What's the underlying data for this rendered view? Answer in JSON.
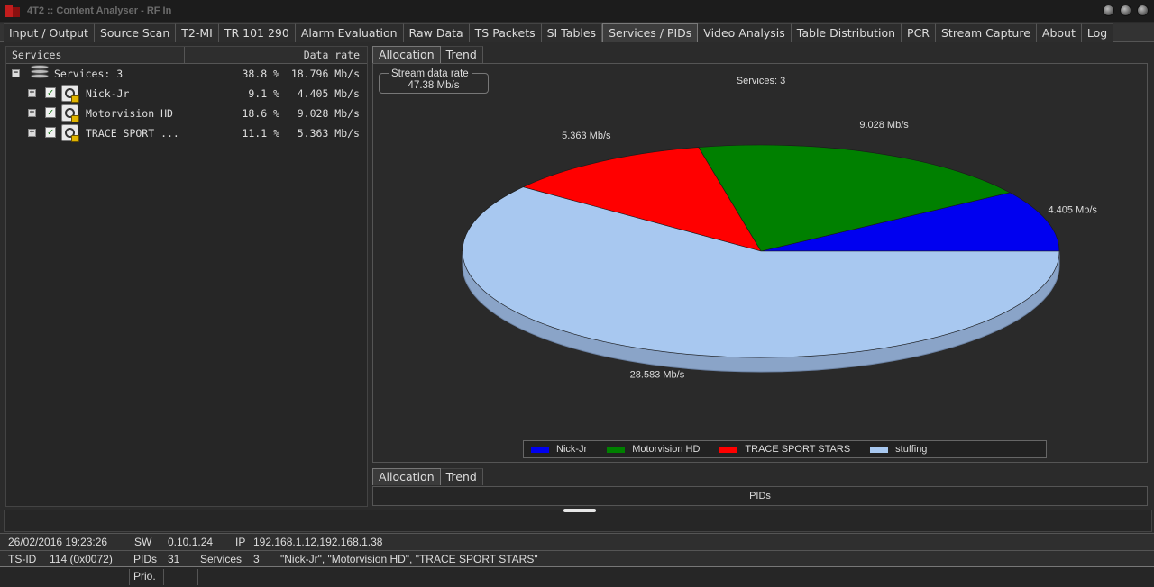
{
  "window": {
    "title": "4T2 :: Content Analyser - RF In"
  },
  "tabs": [
    {
      "label": "Input / Output",
      "active": false
    },
    {
      "label": "Source Scan",
      "active": false
    },
    {
      "label": "T2-MI",
      "active": false
    },
    {
      "label": "TR 101 290",
      "active": false
    },
    {
      "label": "Alarm Evaluation",
      "active": false
    },
    {
      "label": "Raw Data",
      "active": false
    },
    {
      "label": "TS Packets",
      "active": false
    },
    {
      "label": "SI Tables",
      "active": false
    },
    {
      "label": "Services / PIDs",
      "active": true
    },
    {
      "label": "Video Analysis",
      "active": false
    },
    {
      "label": "Table Distribution",
      "active": false
    },
    {
      "label": "PCR",
      "active": false
    },
    {
      "label": "Stream Capture",
      "active": false
    },
    {
      "label": "About",
      "active": false
    },
    {
      "label": "Log",
      "active": false
    }
  ],
  "services_panel": {
    "col_services": "Services",
    "col_datarate": "Data rate",
    "root": {
      "expand": "−",
      "label": "Services: 3",
      "pct": "38.8 %",
      "rate": "18.796 Mb/s"
    },
    "items": [
      {
        "expand": "+",
        "checked": "✓",
        "name": "Nick-Jr",
        "pct": "9.1 %",
        "rate": "4.405 Mb/s"
      },
      {
        "expand": "+",
        "checked": "✓",
        "name": "Motorvision HD",
        "pct": "18.6 %",
        "rate": "9.028 Mb/s"
      },
      {
        "expand": "+",
        "checked": "✓",
        "name": "TRACE SPORT ...",
        "pct": "11.1 %",
        "rate": "5.363 Mb/s"
      }
    ]
  },
  "top_subtabs": {
    "allocation": "Allocation",
    "trend": "Trend"
  },
  "bottom_subtabs": {
    "allocation": "Allocation",
    "trend": "Trend"
  },
  "stream_rate": {
    "label": "Stream data rate",
    "value": "47.38 Mb/s"
  },
  "chart_data": {
    "type": "pie",
    "title": "Services: 3",
    "categories": [
      "Nick-Jr",
      "Motorvision HD",
      "TRACE SPORT STARS",
      "stuffing"
    ],
    "values": [
      4.405,
      9.028,
      5.363,
      28.58
    ],
    "data_labels": [
      "4.405 Mb/s",
      "9.028 Mb/s",
      "5.363 Mb/s",
      "28.583 Mb/s"
    ],
    "colors": [
      "#0000f0",
      "#008000",
      "#ff0000",
      "#a8c8f0"
    ],
    "side_color": "#8aa4c8",
    "legend_position": "bottom",
    "three_d": true
  },
  "pids_bar": {
    "label": "PIDs"
  },
  "status": {
    "datetime": "26/02/2016 19:23:26",
    "sw_label": "SW",
    "sw_value": "0.10.1.24",
    "ip_label": "IP",
    "ip_value": "192.168.1.12,192.168.1.38",
    "tsid_label": "TS-ID",
    "tsid_value": "114 (0x0072)",
    "pids_label": "PIDs",
    "pids_value": "31",
    "services_label": "Services",
    "services_value": "3",
    "services_list": "\"Nick-Jr\", \"Motorvision HD\", \"TRACE SPORT STARS\"",
    "prio_label": "Prio."
  }
}
